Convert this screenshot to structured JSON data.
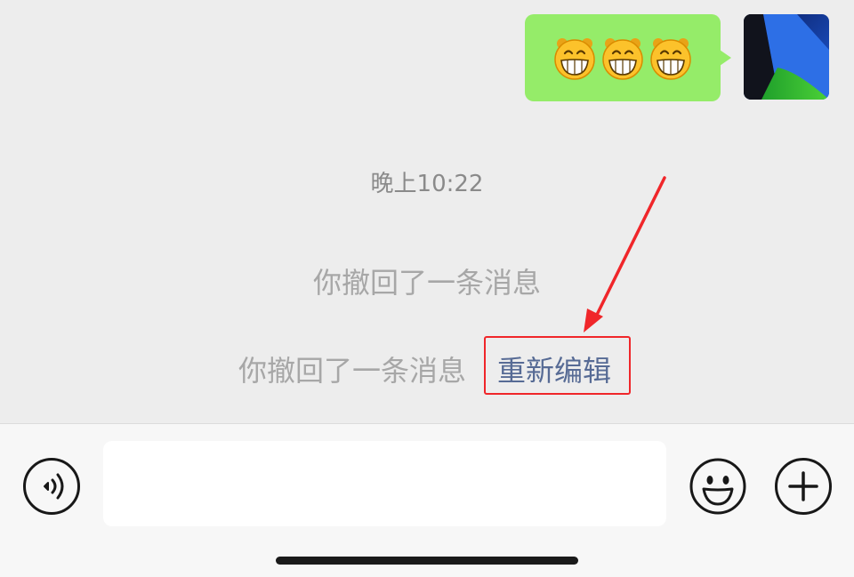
{
  "chat": {
    "message": {
      "emoji_names": [
        "grinning-face-icon",
        "grinning-face-icon",
        "grinning-face-icon"
      ]
    },
    "timestamp": "晚上10:22",
    "recall_notice_1": "你撤回了一条消息",
    "recall_notice_2": "你撤回了一条消息",
    "reedit_label": "重新编辑"
  },
  "input_bar": {
    "text_value": "",
    "voice_icon": "voice-icon",
    "emoji_icon": "emoji-icon",
    "more_icon": "plus-icon"
  },
  "colors": {
    "bubble": "#95ec69",
    "link": "#576b95",
    "annotation": "#f0262a",
    "background": "#ededed"
  }
}
